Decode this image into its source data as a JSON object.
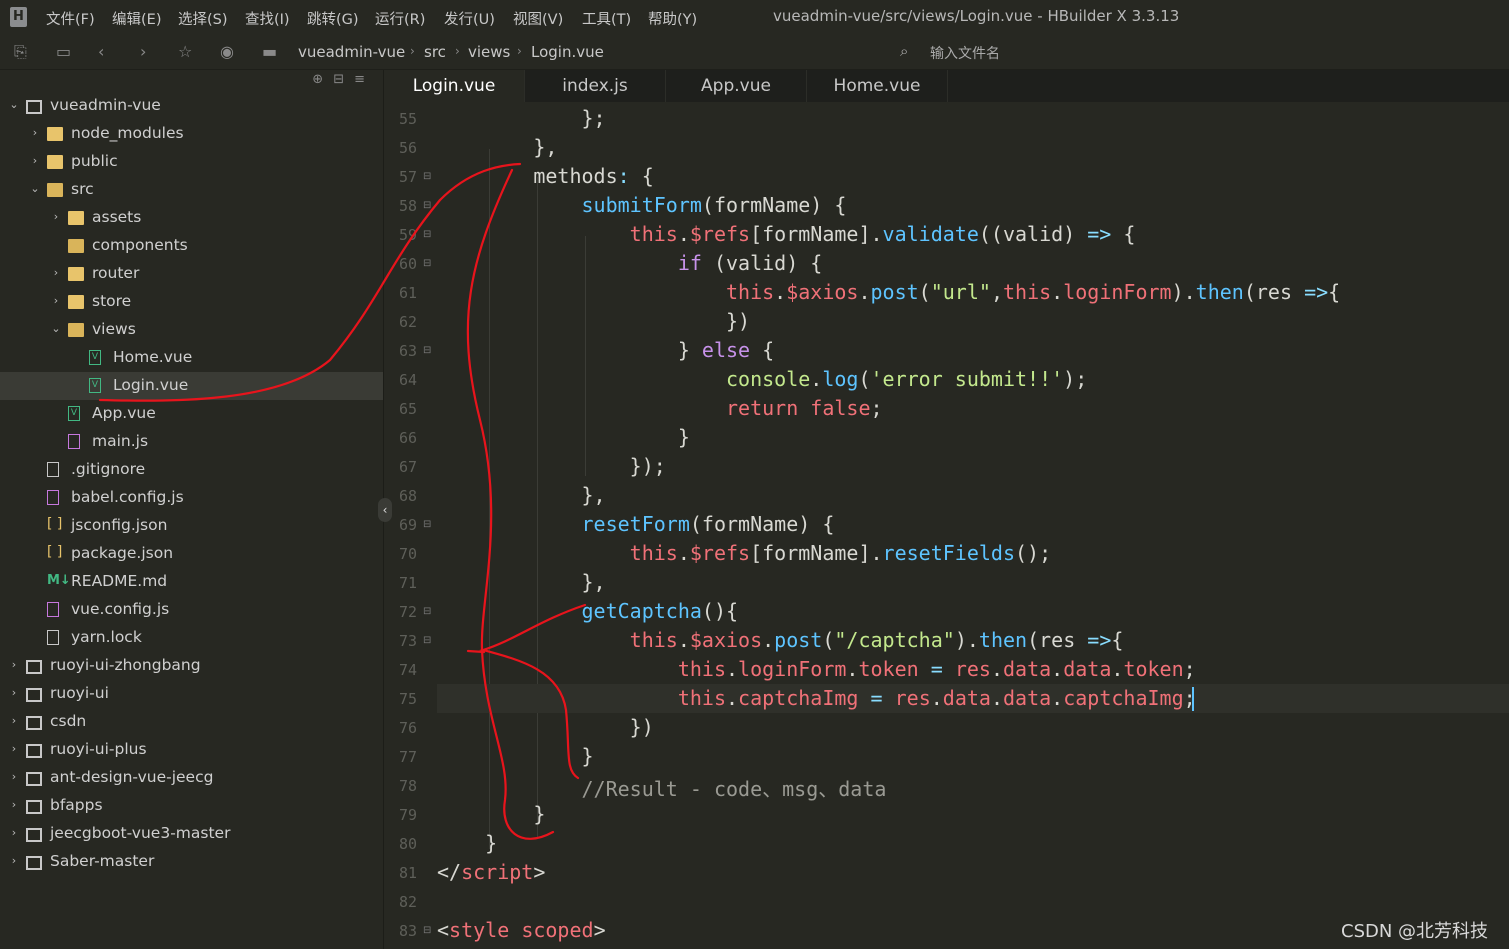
{
  "menubar": {
    "logo": "H",
    "items": [
      "文件(F)",
      "编辑(E)",
      "选择(S)",
      "查找(I)",
      "跳转(G)",
      "运行(R)",
      "发行(U)",
      "视图(V)",
      "工具(T)",
      "帮助(Y)"
    ],
    "title": "vueadmin-vue/src/views/Login.vue - HBuilder X 3.3.13"
  },
  "toolbar": {
    "breadcrumb": [
      "vueadmin-vue",
      "src",
      "views",
      "Login.vue"
    ],
    "file_search_placeholder": "输入文件名"
  },
  "sidebar": {
    "tree": [
      {
        "label": "vueadmin-vue",
        "depth": 0,
        "arrow": "open",
        "icon": "project"
      },
      {
        "label": "node_modules",
        "depth": 1,
        "arrow": "closed",
        "icon": "folder"
      },
      {
        "label": "public",
        "depth": 1,
        "arrow": "closed",
        "icon": "folder"
      },
      {
        "label": "src",
        "depth": 1,
        "arrow": "open",
        "icon": "folder-open"
      },
      {
        "label": "assets",
        "depth": 2,
        "arrow": "closed",
        "icon": "folder"
      },
      {
        "label": "components",
        "depth": 2,
        "arrow": "none",
        "icon": "folder-open"
      },
      {
        "label": "router",
        "depth": 2,
        "arrow": "closed",
        "icon": "folder"
      },
      {
        "label": "store",
        "depth": 2,
        "arrow": "closed",
        "icon": "folder"
      },
      {
        "label": "views",
        "depth": 2,
        "arrow": "open",
        "icon": "folder-open"
      },
      {
        "label": "Home.vue",
        "depth": 3,
        "arrow": "none",
        "icon": "vue"
      },
      {
        "label": "Login.vue",
        "depth": 3,
        "arrow": "none",
        "icon": "vue",
        "selected": true
      },
      {
        "label": "App.vue",
        "depth": 2,
        "arrow": "none",
        "icon": "vue"
      },
      {
        "label": "main.js",
        "depth": 2,
        "arrow": "none",
        "icon": "js"
      },
      {
        "label": ".gitignore",
        "depth": 1,
        "arrow": "none",
        "icon": "doc"
      },
      {
        "label": "babel.config.js",
        "depth": 1,
        "arrow": "none",
        "icon": "js"
      },
      {
        "label": "jsconfig.json",
        "depth": 1,
        "arrow": "none",
        "icon": "json"
      },
      {
        "label": "package.json",
        "depth": 1,
        "arrow": "none",
        "icon": "json"
      },
      {
        "label": "README.md",
        "depth": 1,
        "arrow": "none",
        "icon": "md"
      },
      {
        "label": "vue.config.js",
        "depth": 1,
        "arrow": "none",
        "icon": "js"
      },
      {
        "label": "yarn.lock",
        "depth": 1,
        "arrow": "none",
        "icon": "doc"
      },
      {
        "label": "ruoyi-ui-zhongbang",
        "depth": 0,
        "arrow": "closed",
        "icon": "project"
      },
      {
        "label": "ruoyi-ui",
        "depth": 0,
        "arrow": "closed",
        "icon": "project"
      },
      {
        "label": "csdn",
        "depth": 0,
        "arrow": "closed",
        "icon": "project"
      },
      {
        "label": "ruoyi-ui-plus",
        "depth": 0,
        "arrow": "closed",
        "icon": "project"
      },
      {
        "label": "ant-design-vue-jeecg",
        "depth": 0,
        "arrow": "closed",
        "icon": "project"
      },
      {
        "label": "bfapps",
        "depth": 0,
        "arrow": "closed",
        "icon": "project"
      },
      {
        "label": "jeecgboot-vue3-master",
        "depth": 0,
        "arrow": "closed",
        "icon": "project"
      },
      {
        "label": "Saber-master",
        "depth": 0,
        "arrow": "closed",
        "icon": "project"
      }
    ],
    "json_icon_text": "[ ]",
    "md_icon_text": "M↓"
  },
  "tabs": [
    {
      "label": "Login.vue",
      "active": true
    },
    {
      "label": "index.js",
      "active": false
    },
    {
      "label": "App.vue",
      "active": false
    },
    {
      "label": "Home.vue",
      "active": false
    }
  ],
  "editor": {
    "lines": [
      {
        "num": "55",
        "fold": false,
        "html": "            };"
      },
      {
        "num": "56",
        "fold": false,
        "html": "        },"
      },
      {
        "num": "57",
        "fold": true,
        "html": "        methods<span class=\"op\">:</span> {"
      },
      {
        "num": "58",
        "fold": true,
        "html": "            <span class=\"fn\">submitForm</span>(formName) {"
      },
      {
        "num": "59",
        "fold": true,
        "html": "                <span class=\"kw\">this</span>.<span class=\"kw\">$refs</span>[formName].<span class=\"fn\">validate</span>((valid) <span class=\"op\">=&gt;</span> {"
      },
      {
        "num": "60",
        "fold": true,
        "html": "                    <span class=\"kw2\">if</span> (valid) {"
      },
      {
        "num": "61",
        "fold": false,
        "html": "                        <span class=\"kw\">this</span>.<span class=\"kw\">$axios</span>.<span class=\"fn\">post</span>(<span class=\"str\">\"url\"</span>,<span class=\"kw\">this</span>.<span class=\"kw\">loginForm</span>).<span class=\"fn\">then</span>(res <span class=\"op\">=&gt;</span>{"
      },
      {
        "num": "62",
        "fold": false,
        "html": "                        })"
      },
      {
        "num": "63",
        "fold": true,
        "html": "                    } <span class=\"kw2\">else</span> {"
      },
      {
        "num": "64",
        "fold": false,
        "html": "                        <span class=\"str\">console</span>.<span class=\"fn\">log</span>(<span class=\"str\">'error submit!!'</span>);"
      },
      {
        "num": "65",
        "fold": false,
        "html": "                        <span class=\"kw\">return</span> <span class=\"kw\">false</span>;"
      },
      {
        "num": "66",
        "fold": false,
        "html": "                    }"
      },
      {
        "num": "67",
        "fold": false,
        "html": "                });"
      },
      {
        "num": "68",
        "fold": false,
        "html": "            },"
      },
      {
        "num": "69",
        "fold": true,
        "html": "            <span class=\"fn\">resetForm</span>(formName) {"
      },
      {
        "num": "70",
        "fold": false,
        "html": "                <span class=\"kw\">this</span>.<span class=\"kw\">$refs</span>[formName].<span class=\"fn\">resetFields</span>();"
      },
      {
        "num": "71",
        "fold": false,
        "html": "            },"
      },
      {
        "num": "72",
        "fold": true,
        "html": "            <span class=\"fn\">getCaptcha</span>(){"
      },
      {
        "num": "73",
        "fold": true,
        "html": "                <span class=\"kw\">this</span>.<span class=\"kw\">$axios</span>.<span class=\"fn\">post</span>(<span class=\"str\">\"/captcha\"</span>).<span class=\"fn\">then</span>(res <span class=\"op\">=&gt;</span>{"
      },
      {
        "num": "74",
        "fold": false,
        "html": "                    <span class=\"kw\">this</span>.<span class=\"kw\">loginForm</span>.<span class=\"kw\">token</span> <span class=\"op\">=</span> <span class=\"kw\">res</span>.<span class=\"kw\">data</span>.<span class=\"kw\">data</span>.<span class=\"kw\">token</span>;"
      },
      {
        "num": "75",
        "fold": false,
        "html": "                    <span class=\"kw\">this</span>.<span class=\"kw\">captchaImg</span> <span class=\"op\">=</span> <span class=\"kw\">res</span>.<span class=\"kw\">data</span>.<span class=\"kw\">data</span>.<span class=\"kw\">captchaImg</span>;",
        "current": true
      },
      {
        "num": "76",
        "fold": false,
        "html": "                })"
      },
      {
        "num": "77",
        "fold": false,
        "html": "            }"
      },
      {
        "num": "78",
        "fold": false,
        "html": "            <span class=\"cm\">//Result - code、msg、data</span>"
      },
      {
        "num": "79",
        "fold": false,
        "html": "        }"
      },
      {
        "num": "80",
        "fold": false,
        "html": "    }"
      },
      {
        "num": "81",
        "fold": false,
        "html": "&lt;/<span class=\"tag\">script</span>&gt;"
      },
      {
        "num": "82",
        "fold": false,
        "html": ""
      },
      {
        "num": "83",
        "fold": true,
        "html": "&lt;<span class=\"tag\">style</span> <span class=\"kw\">scoped</span>&gt;"
      }
    ]
  },
  "watermark": "CSDN @北芳科技"
}
